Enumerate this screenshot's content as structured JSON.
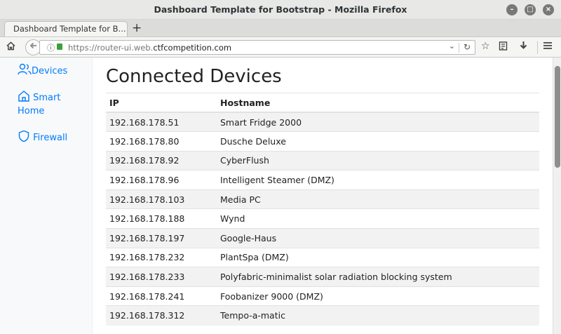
{
  "window": {
    "title": "Dashboard Template for Bootstrap - Mozilla Firefox"
  },
  "tab": {
    "label": "Dashboard Template for B..."
  },
  "urlbar": {
    "scheme": "https://",
    "host_prefix": "router-ui.web.",
    "host": "ctfcompetition.com"
  },
  "icons": {
    "home": "home-icon",
    "back": "back-arrow-icon",
    "info": "info-icon",
    "lock": "lock-icon",
    "reload": "reload-icon",
    "bookmark": "star-icon",
    "reader": "reading-list-icon",
    "download": "download-icon",
    "menu": "hamburger-menu-icon"
  },
  "sidebar": {
    "items": [
      {
        "label": "Devices",
        "icon": "users-icon"
      },
      {
        "label": "Smart",
        "label2": "Home",
        "icon": "house-icon"
      },
      {
        "label": "Firewall",
        "icon": "shield-icon"
      }
    ]
  },
  "main": {
    "title": "Connected Devices",
    "table": {
      "headers": [
        "IP",
        "Hostname"
      ],
      "rows": [
        [
          "192.168.178.51",
          "Smart Fridge 2000"
        ],
        [
          "192.168.178.80",
          "Dusche Deluxe"
        ],
        [
          "192.168.178.92",
          "CyberFlush"
        ],
        [
          "192.168.178.96",
          "Intelligent Steamer (DMZ)"
        ],
        [
          "192.168.178.103",
          "Media PC"
        ],
        [
          "192.168.178.188",
          "Wynd"
        ],
        [
          "192.168.178.197",
          "Google-Haus"
        ],
        [
          "192.168.178.232",
          "PlantSpa (DMZ)"
        ],
        [
          "192.168.178.233",
          "Polyfabric-minimalist solar radiation blocking system"
        ],
        [
          "192.168.178.241",
          "Foobanizer 9000 (DMZ)"
        ],
        [
          "192.168.178.312",
          "Tempo-a-matic"
        ]
      ]
    }
  },
  "colors": {
    "link": "#007bff",
    "stripe": "#f2f2f2",
    "sidebar_bg": "#f8f9fa"
  }
}
